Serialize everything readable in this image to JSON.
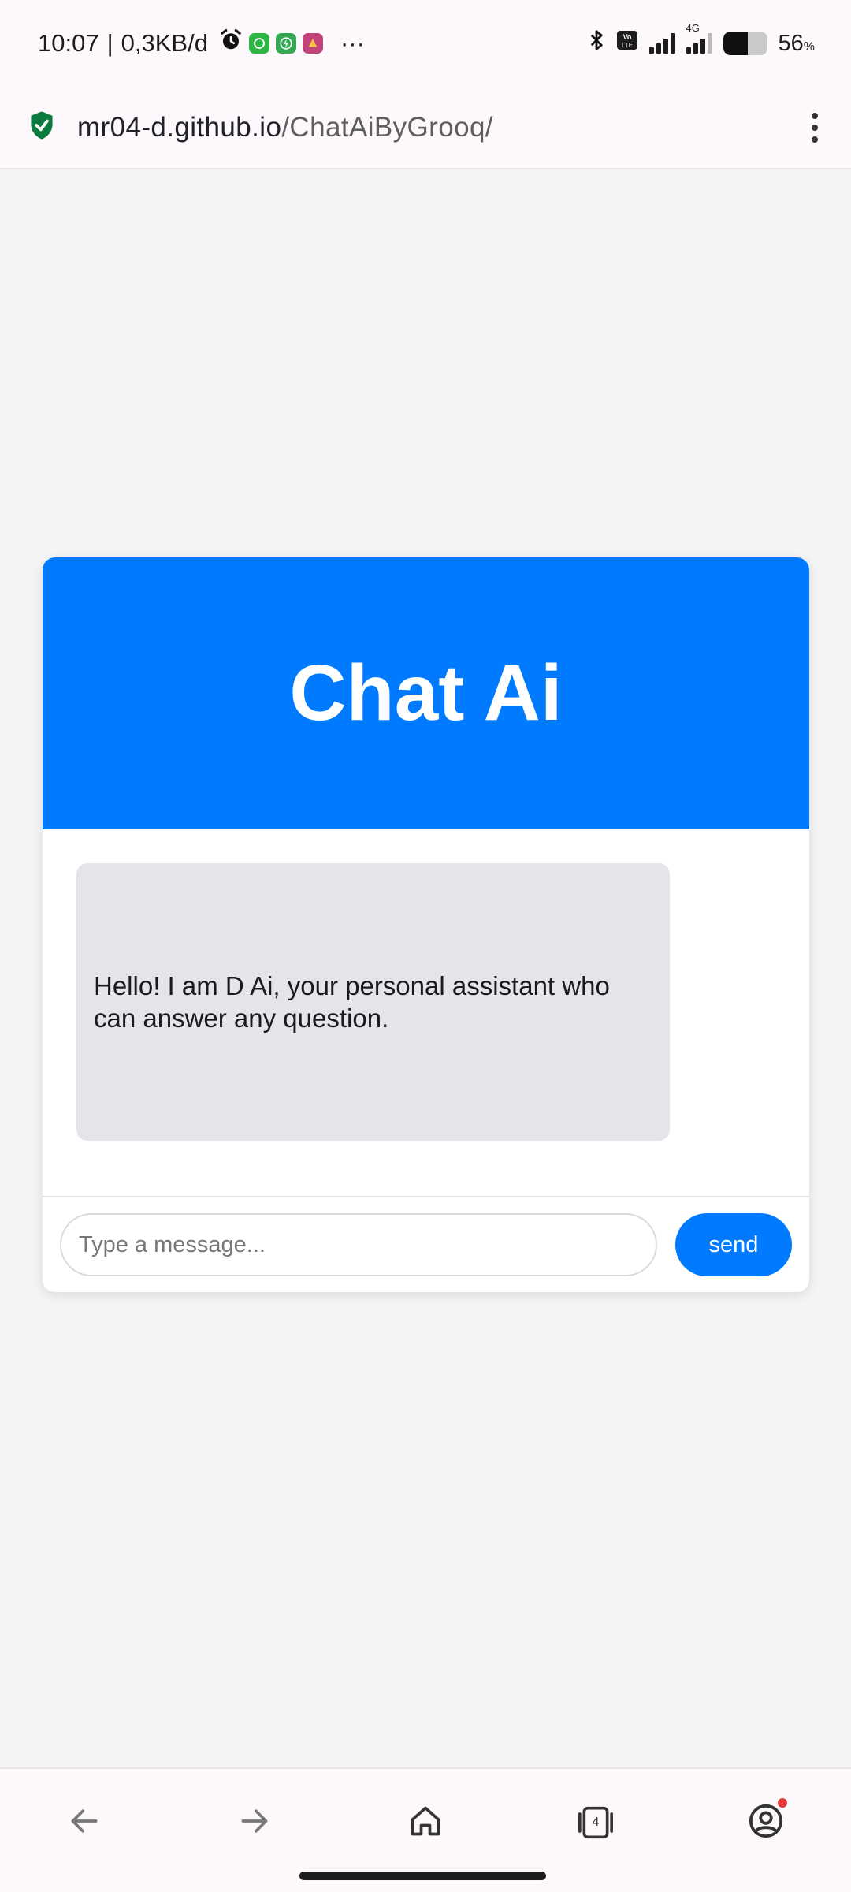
{
  "status_bar": {
    "time": "10:07",
    "separator": "|",
    "network_speed": "0,3KB/d",
    "more": "···",
    "network_type": "4G",
    "battery_percent": "56",
    "battery_percent_sign": "%",
    "battery_level": 0.56
  },
  "url_bar": {
    "domain": "mr04-d.github.io",
    "path": "/ChatAiByGrooq/"
  },
  "chat": {
    "title": "Chat Ai",
    "messages": [
      {
        "sender": "bot",
        "text": "Hello! I am D Ai, your personal assistant who can answer any question."
      }
    ],
    "input": {
      "value": "",
      "placeholder": "Type a message..."
    },
    "send_label": "send"
  },
  "bottom_nav": {
    "tab_count": "4"
  },
  "colors": {
    "accent": "#007bff",
    "bubble": "#e4e5ea",
    "page_bg": "#f4f4f4",
    "secure_shield": "#0b7a3e",
    "notification_dot": "#e53935"
  },
  "icons": [
    "alarm-icon",
    "whatsapp-icon",
    "charging-app-icon",
    "app-icon",
    "bluetooth-icon",
    "volte-icon",
    "signal-icon",
    "battery-icon",
    "secure-shield-icon",
    "more-vert-icon",
    "back-arrow-icon",
    "forward-arrow-icon",
    "home-icon",
    "tabs-icon",
    "account-icon"
  ]
}
